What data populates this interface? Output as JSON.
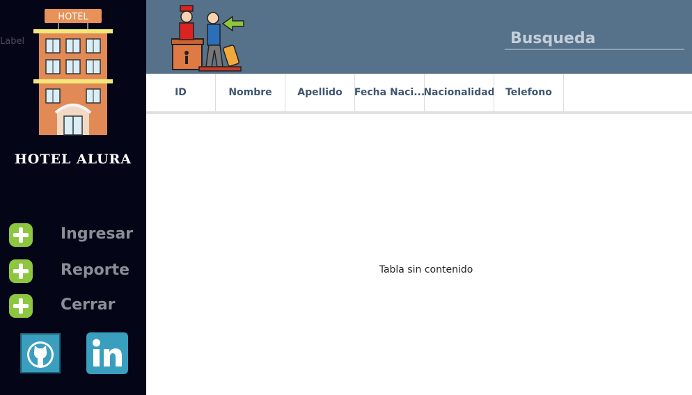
{
  "sidebar": {
    "stray_label": "Label",
    "logo_sign": "HOTEL",
    "hotel_name": "HOTEL ALURA",
    "menu": [
      {
        "label": "Ingresar",
        "icon": "plus-icon"
      },
      {
        "label": "Reporte",
        "icon": "plus-icon"
      },
      {
        "label": "Cerrar",
        "icon": "plus-icon"
      }
    ],
    "social": [
      {
        "icon": "github-icon"
      },
      {
        "icon": "linkedin-icon"
      }
    ]
  },
  "header": {
    "search": {
      "placeholder": "Busqueda",
      "value": ""
    }
  },
  "table": {
    "columns": [
      "ID",
      "Nombre",
      "Apellido",
      "Fecha Naci...",
      "Nacionalidad",
      "Telefono"
    ],
    "rows": [],
    "empty_text": "Tabla sin contenido"
  },
  "colors": {
    "sidebar_bg": "#050518",
    "header_bg": "#56718a",
    "accent_green": "#8dc63f",
    "social_blue": "#3a9fbf"
  }
}
